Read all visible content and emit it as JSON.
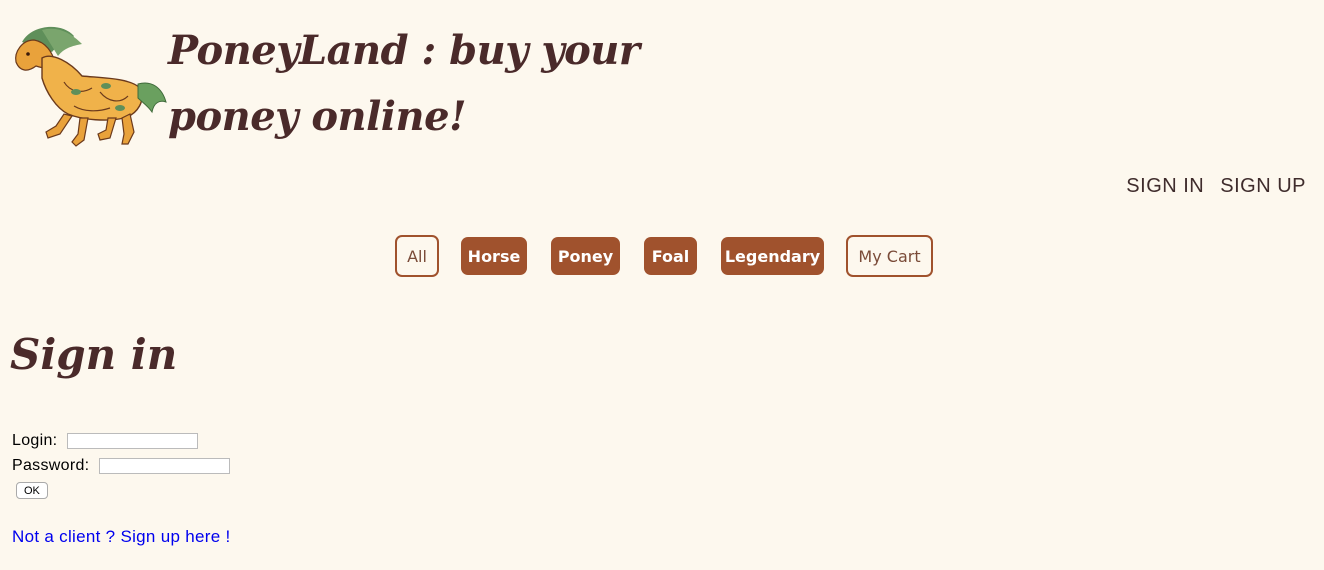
{
  "header": {
    "logo_icon": "horse-logo-icon",
    "title": "PoneyLand : buy your poney online!"
  },
  "auth": {
    "sign_in": "SIGN IN",
    "sign_up": "SIGN UP"
  },
  "nav": {
    "items": [
      {
        "label": "All",
        "style": "outline"
      },
      {
        "label": "Horse",
        "style": "filled"
      },
      {
        "label": "Poney",
        "style": "filled"
      },
      {
        "label": "Foal",
        "style": "filled"
      },
      {
        "label": "Legendary",
        "style": "filled"
      },
      {
        "label": "My Cart",
        "style": "outline"
      }
    ]
  },
  "main": {
    "heading": "Sign in",
    "form": {
      "login_label": "Login:",
      "login_value": "",
      "password_label": "Password:",
      "password_value": "",
      "ok_label": "OK"
    },
    "signup_link": "Not a client ? Sign up here !"
  },
  "colors": {
    "background": "#fdf8ee",
    "accent": "#a0522d",
    "title_text": "#4a2a2a",
    "link": "#0000ee"
  }
}
